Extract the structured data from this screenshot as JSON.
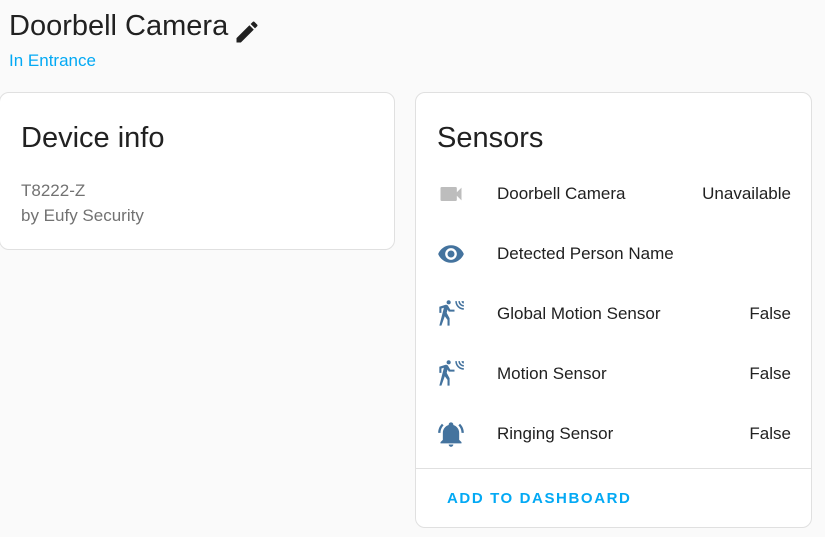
{
  "header": {
    "title": "Doorbell Camera",
    "area_link": "In Entrance",
    "edit_icon": "pencil-icon"
  },
  "device_info": {
    "title": "Device info",
    "model": "T8222-Z",
    "manufacturer": "by Eufy Security"
  },
  "sensors": {
    "title": "Sensors",
    "items": [
      {
        "name": "Doorbell Camera",
        "state": "Unavailable",
        "icon": "video-camera-icon"
      },
      {
        "name": "Detected Person Name",
        "state": "",
        "icon": "eye-icon"
      },
      {
        "name": "Global Motion Sensor",
        "state": "False",
        "icon": "motion-sensor-icon"
      },
      {
        "name": "Motion Sensor",
        "state": "False",
        "icon": "motion-sensor-icon"
      },
      {
        "name": "Ringing Sensor",
        "state": "False",
        "icon": "bell-ring-icon"
      }
    ],
    "add_to_dashboard": "ADD TO DASHBOARD"
  },
  "colors": {
    "accent": "#03a9f4",
    "icon_blue": "#44739e",
    "icon_disabled": "#bdbdbd",
    "background": "#fafafa",
    "card": "#ffffff"
  }
}
